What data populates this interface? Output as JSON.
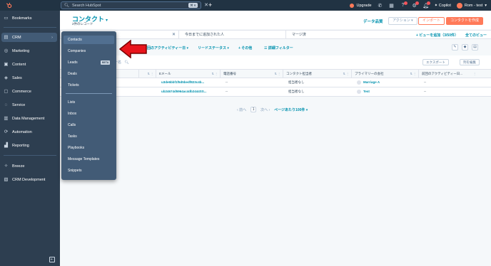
{
  "topbar": {
    "search_placeholder": "Search HubSpot",
    "shortcut": "⌘ K",
    "upgrade_label": "Upgrade",
    "copilot_label": "Copilot",
    "account_name": "Rom - test"
  },
  "sidebar": {
    "items": [
      {
        "label": "Bookmarks",
        "icon": "bookmark-icon"
      },
      {
        "label": "CRM",
        "icon": "crm-icon"
      },
      {
        "label": "Marketing",
        "icon": "marketing-icon"
      },
      {
        "label": "Content",
        "icon": "content-icon"
      },
      {
        "label": "Sales",
        "icon": "sales-icon"
      },
      {
        "label": "Commerce",
        "icon": "commerce-icon"
      },
      {
        "label": "Service",
        "icon": "service-icon"
      },
      {
        "label": "Data Management",
        "icon": "data-icon"
      },
      {
        "label": "Automation",
        "icon": "automation-icon"
      },
      {
        "label": "Reporting",
        "icon": "reporting-icon"
      },
      {
        "label": "Breeze",
        "icon": "breeze-icon"
      },
      {
        "label": "CRM Development",
        "icon": "dev-icon"
      }
    ]
  },
  "header": {
    "title": "コンタクト",
    "subtitle": "2件のレコード",
    "data_quality": "データ品質",
    "actions": "アクション ▾",
    "import": "インポート",
    "create": "コンタクトを作成"
  },
  "tabs": {
    "items": [
      "今日までに追加された人",
      "マージ済"
    ],
    "add_view": "+ ビューを追加（3/50件）",
    "all_views": "全てのビュー"
  },
  "filters": {
    "items": [
      "前回のアクティビティー日 ▾",
      "リードステータス ▾",
      "+ その他",
      "☰ 詳細フィルター"
    ]
  },
  "table": {
    "export": "エクスポート",
    "edit_columns": "列を編集",
    "search_suffix": "ー名",
    "columns": [
      "Eメール",
      "電話番号",
      "コンタクト担当者",
      "プライマリーの会社",
      "前回のアクティビティー日..."
    ],
    "rows": [
      {
        "email": "u3de6bbf1f5d5bedf823c4b...",
        "phone": "--",
        "owner": "担当者なし",
        "company": "Marriage A",
        "activity": "--"
      },
      {
        "email": "ub24674d5964ac4db2444SS...",
        "phone": "--",
        "owner": "担当者なし",
        "company": "Test",
        "activity": "--"
      }
    ]
  },
  "pager": {
    "prev": "前へ",
    "page": "1",
    "next": "次へ",
    "per_page": "ページあたり100件 ▾"
  },
  "flyout": {
    "items": [
      "Contacts",
      "Companies",
      "Leads",
      "Deals",
      "Tickets",
      "Lists",
      "Inbox",
      "Calls",
      "Tasks",
      "Playbooks",
      "Message Templates",
      "Snippets"
    ],
    "beta_label": "BETA"
  },
  "colors": {
    "topbar": "#213343",
    "sidebar": "#2d3e50",
    "flyout": "#425b76",
    "accent": "#ff7a59",
    "link": "#0091ae",
    "arrow": "#e8141b"
  }
}
